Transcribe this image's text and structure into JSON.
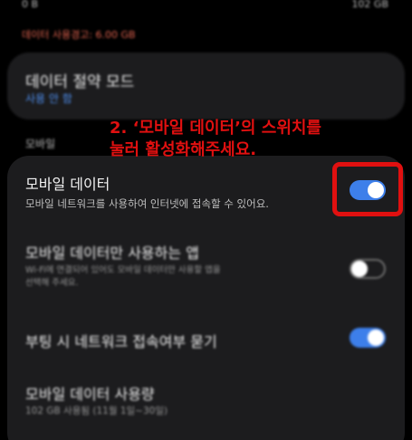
{
  "top": {
    "left_text": "0 B",
    "right_text": "102 GB"
  },
  "warning_text": "데이터 사용경고: 6.00 GB",
  "saver": {
    "title": "데이터 절약 모드",
    "status": "사용 안 함"
  },
  "section_label": "모바일",
  "rows": [
    {
      "title": "모바일 데이터",
      "desc": "모바일 네트워크를 사용하여 인터넷에 접속할 수 있어요.",
      "toggle": "on"
    },
    {
      "title": "모바일 데이터만 사용하는 앱",
      "desc_line1": "Wi-Fi에 연결되어 있어도 모바일 데이터만 사용할 앱을",
      "desc_line2": "선택해 주세요.",
      "toggle": "off"
    },
    {
      "title": "부팅 시 네트워크 접속여부 묻기",
      "toggle": "on"
    },
    {
      "title": "모바일 데이터 사용량",
      "desc": "102 GB 사용됨 (11월 1일~30일)"
    }
  ],
  "annotation": {
    "line1": "2. ‘모바일 데이터’의 스위치를",
    "line2": "눌러 활성화해주세요."
  },
  "colors": {
    "accent": "#3d7fea",
    "annotation": "#e01010",
    "warning": "#e0624e"
  }
}
